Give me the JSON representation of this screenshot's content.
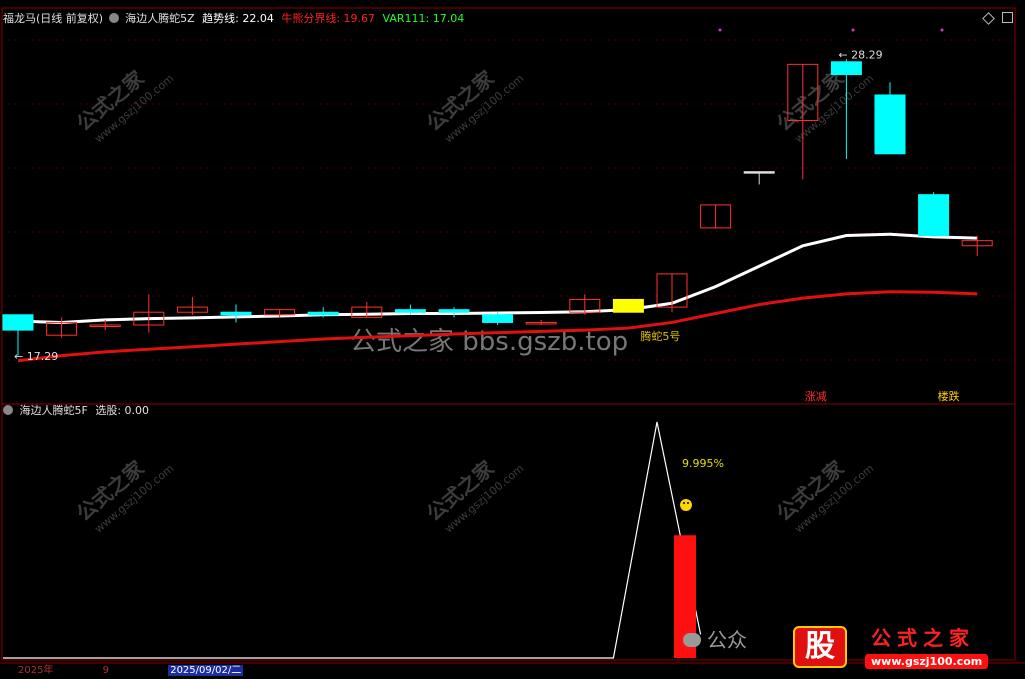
{
  "header": {
    "symbol_period": "福龙马(日线 前复权)",
    "indicator_name": "海边人腾蛇5Z",
    "trend_label": "趋势线: 22.04",
    "bull_bear_label": "牛熊分界线: 19.67",
    "var_label": "VAR111: 17.04"
  },
  "sub_header": {
    "indicator_name": "海边人腾蛇5F",
    "select_label": "选股: 0.00"
  },
  "x_axis": {
    "year_label": "2025年",
    "month_label": "9",
    "cursor_date": "2025/09/02/二"
  },
  "watermark": {
    "center_text": "公式之家 bbs.gszb.top",
    "bottom_text": "公众",
    "logo_badge": "股",
    "logo_name": "公式之家",
    "logo_url": "www.gszj100.com",
    "tile_text": "公式之家",
    "tile_url": "www.gszj100.com"
  },
  "colors": {
    "up": "#ff3030",
    "down": "#00ffff",
    "trend": "#ffffff",
    "bullbear": "#e01010",
    "signal": "#ffff00",
    "panel_border": "#8b0000"
  },
  "chart_data": {
    "type": "candlestick",
    "price_range": [
      15.8,
      30.2
    ],
    "high_label": "28.29",
    "low_label": "17.29",
    "candles": [
      {
        "o": 18.9,
        "c": 18.3,
        "h": 18.9,
        "l": 17.3,
        "color": "down"
      },
      {
        "o": 18.1,
        "c": 18.6,
        "h": 18.8,
        "l": 18.0,
        "color": "up"
      },
      {
        "o": 18.5,
        "c": 18.5,
        "h": 18.7,
        "l": 18.3,
        "color": "up"
      },
      {
        "o": 18.5,
        "c": 19.0,
        "h": 19.7,
        "l": 18.2,
        "color": "up"
      },
      {
        "o": 19.0,
        "c": 19.2,
        "h": 19.6,
        "l": 18.9,
        "color": "up"
      },
      {
        "o": 19.0,
        "c": 18.9,
        "h": 19.3,
        "l": 18.6,
        "color": "down"
      },
      {
        "o": 18.9,
        "c": 19.1,
        "h": 19.1,
        "l": 18.8,
        "color": "up"
      },
      {
        "o": 19.0,
        "c": 18.9,
        "h": 19.2,
        "l": 18.8,
        "color": "down"
      },
      {
        "o": 18.8,
        "c": 19.2,
        "h": 19.4,
        "l": 18.8,
        "color": "up"
      },
      {
        "o": 19.0,
        "c": 19.1,
        "h": 19.3,
        "l": 18.9,
        "color": "down"
      },
      {
        "o": 19.1,
        "c": 19.0,
        "h": 19.2,
        "l": 18.8,
        "color": "down"
      },
      {
        "o": 18.9,
        "c": 18.6,
        "h": 19.0,
        "l": 18.5,
        "color": "down"
      },
      {
        "o": 18.6,
        "c": 18.6,
        "h": 18.7,
        "l": 18.5,
        "color": "up"
      },
      {
        "o": 19.0,
        "c": 19.5,
        "h": 19.7,
        "l": 18.9,
        "color": "up"
      },
      {
        "o": 19.0,
        "c": 19.5,
        "h": 19.5,
        "l": 19.0,
        "color": "signal"
      },
      {
        "o": 19.2,
        "c": 20.5,
        "h": 20.5,
        "l": 19.0,
        "color": "up"
      },
      {
        "o": 22.3,
        "c": 23.2,
        "h": 23.2,
        "l": 22.3,
        "color": "up"
      },
      {
        "o": 24.5,
        "c": 24.5,
        "h": 24.5,
        "l": 24.0,
        "color": "flat"
      },
      {
        "o": 26.5,
        "c": 28.7,
        "h": 28.7,
        "l": 24.2,
        "color": "up"
      },
      {
        "o": 28.3,
        "c": 28.8,
        "h": 28.9,
        "l": 25.0,
        "color": "down"
      },
      {
        "o": 27.5,
        "c": 25.2,
        "h": 28.0,
        "l": 25.2,
        "color": "down"
      },
      {
        "o": 23.6,
        "c": 22.0,
        "h": 23.7,
        "l": 22.0,
        "color": "down"
      },
      {
        "o": 21.8,
        "c": 21.6,
        "h": 22.0,
        "l": 21.2,
        "color": "up"
      }
    ],
    "series": [
      {
        "name": "趋势线",
        "values": [
          18.65,
          18.6,
          18.7,
          18.75,
          18.78,
          18.82,
          18.85,
          18.9,
          18.92,
          18.95,
          18.95,
          18.97,
          18.99,
          19.02,
          19.1,
          19.35,
          20.0,
          20.8,
          21.6,
          22.0,
          22.05,
          21.95,
          21.9
        ]
      },
      {
        "name": "牛熊分界线",
        "values": [
          17.1,
          17.3,
          17.45,
          17.55,
          17.65,
          17.75,
          17.85,
          17.95,
          18.02,
          18.08,
          18.15,
          18.2,
          18.25,
          18.3,
          18.38,
          18.6,
          18.95,
          19.3,
          19.55,
          19.72,
          19.8,
          19.78,
          19.72
        ]
      }
    ],
    "annotations": {
      "bars_label": "腾蛇5号",
      "rise_label": "涨减",
      "drop_label": "楼跌"
    },
    "sub_panel": {
      "line_values": [
        0,
        0,
        0,
        0,
        0,
        0,
        0,
        0,
        0,
        0,
        0,
        0,
        0,
        0,
        0,
        1,
        0.1
      ],
      "bar_value": 0.52,
      "bar_label": "9.995%",
      "smile_icon": "smiley"
    }
  }
}
